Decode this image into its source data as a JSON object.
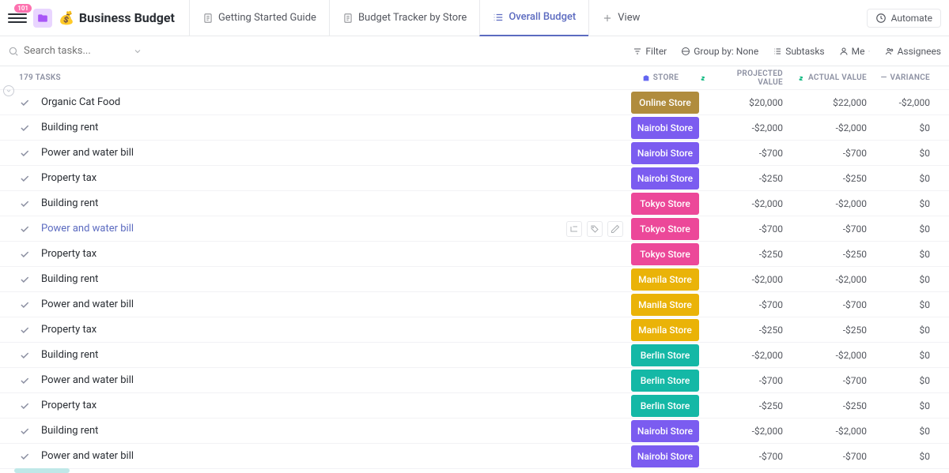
{
  "header": {
    "badge": "101",
    "emoji": "💰",
    "title": "Business Budget"
  },
  "tabs": [
    {
      "name": "getting-started",
      "label": "Getting Started Guide",
      "icon": "doc"
    },
    {
      "name": "budget-tracker",
      "label": "Budget Tracker by Store",
      "icon": "doc"
    },
    {
      "name": "overall-budget",
      "label": "Overall Budget",
      "icon": "list",
      "active": true
    },
    {
      "name": "add-view",
      "label": "View",
      "icon": "plus"
    }
  ],
  "automate": "Automate",
  "toolbar": {
    "search_placeholder": "Search tasks...",
    "filter": "Filter",
    "group_by": "Group by: None",
    "subtasks": "Subtasks",
    "me": "Me",
    "assignees": "Assignees"
  },
  "columns": {
    "tasks_count": "179 TASKS",
    "store": "STORE",
    "projected": "PROJECTED VALUE",
    "actual": "ACTUAL VALUE",
    "variance": "VARIANCE"
  },
  "stores": {
    "online": {
      "label": "Online Store",
      "color": "#b08c3d"
    },
    "nairobi": {
      "label": "Nairobi Store",
      "color": "#7b5cf0"
    },
    "tokyo": {
      "label": "Tokyo Store",
      "color": "#ec4899"
    },
    "manila": {
      "label": "Manila Store",
      "color": "#eab308"
    },
    "berlin": {
      "label": "Berlin Store",
      "color": "#14b8a6"
    }
  },
  "rows": [
    {
      "name": "Organic Cat Food",
      "store": "online",
      "projected": "$20,000",
      "actual": "$22,000",
      "variance": "-$2,000"
    },
    {
      "name": "Building rent",
      "store": "nairobi",
      "projected": "-$2,000",
      "actual": "-$2,000",
      "variance": "$0"
    },
    {
      "name": "Power and water bill",
      "store": "nairobi",
      "projected": "-$700",
      "actual": "-$700",
      "variance": "$0"
    },
    {
      "name": "Property tax",
      "store": "nairobi",
      "projected": "-$250",
      "actual": "-$250",
      "variance": "$0"
    },
    {
      "name": "Building rent",
      "store": "tokyo",
      "projected": "-$2,000",
      "actual": "-$2,000",
      "variance": "$0"
    },
    {
      "name": "Power and water bill",
      "store": "tokyo",
      "projected": "-$700",
      "actual": "-$700",
      "variance": "$0",
      "highlighted": true
    },
    {
      "name": "Property tax",
      "store": "tokyo",
      "projected": "-$250",
      "actual": "-$250",
      "variance": "$0"
    },
    {
      "name": "Building rent",
      "store": "manila",
      "projected": "-$2,000",
      "actual": "-$2,000",
      "variance": "$0"
    },
    {
      "name": "Power and water bill",
      "store": "manila",
      "projected": "-$700",
      "actual": "-$700",
      "variance": "$0"
    },
    {
      "name": "Property tax",
      "store": "manila",
      "projected": "-$250",
      "actual": "-$250",
      "variance": "$0"
    },
    {
      "name": "Building rent",
      "store": "berlin",
      "projected": "-$2,000",
      "actual": "-$2,000",
      "variance": "$0"
    },
    {
      "name": "Power and water bill",
      "store": "berlin",
      "projected": "-$700",
      "actual": "-$700",
      "variance": "$0"
    },
    {
      "name": "Property tax",
      "store": "berlin",
      "projected": "-$250",
      "actual": "-$250",
      "variance": "$0"
    },
    {
      "name": "Building rent",
      "store": "nairobi",
      "projected": "-$2,000",
      "actual": "-$2,000",
      "variance": "$0"
    },
    {
      "name": "Power and water bill",
      "store": "nairobi",
      "projected": "-$700",
      "actual": "-$700",
      "variance": "$0"
    }
  ]
}
